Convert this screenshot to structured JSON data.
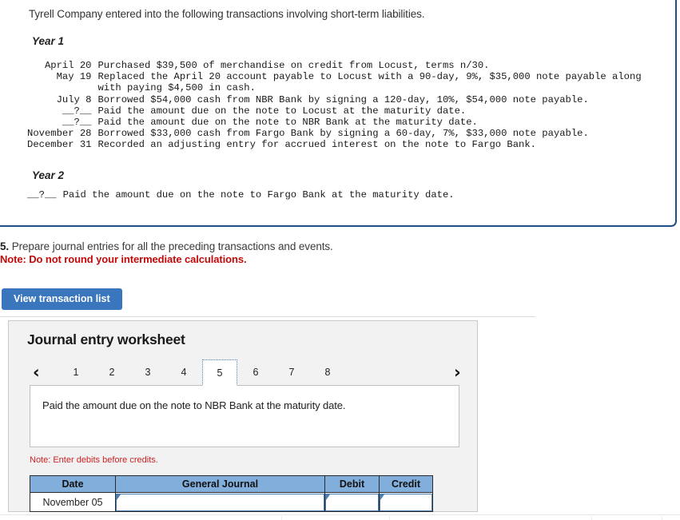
{
  "problem": {
    "intro": "Tyrell Company entered into the following transactions involving short-term liabilities.",
    "year1_label": "Year 1",
    "year2_label": "Year 2",
    "year1_transactions": [
      {
        "date": "April 20",
        "text": "Purchased $39,500 of merchandise on credit from Locust, terms n/30."
      },
      {
        "date": "May 19",
        "text": "Replaced the April 20 account payable to Locust with a 90-day, 9%, $35,000 note payable along"
      },
      {
        "date": "",
        "text": "with paying $4,500 in cash."
      },
      {
        "date": "July 8",
        "text": "Borrowed $54,000 cash from NBR Bank by signing a 120-day, 10%, $54,000 note payable."
      },
      {
        "date": "__?__",
        "text": "Paid the amount due on the note to Locust at the maturity date."
      },
      {
        "date": "__?__",
        "text": "Paid the amount due on the note to NBR Bank at the maturity date."
      },
      {
        "date": "November 28",
        "text": "Borrowed $33,000 cash from Fargo Bank by signing a 60-day, 7%, $33,000 note payable."
      },
      {
        "date": "December 31",
        "text": "Recorded an adjusting entry for accrued interest on the note to Fargo Bank."
      }
    ],
    "year2_transactions": [
      {
        "date": "__?__",
        "text": "Paid the amount due on the note to Fargo Bank at the maturity date."
      }
    ]
  },
  "requirement": {
    "number": "5.",
    "text": "Prepare journal entries for all the preceding transactions and events.",
    "note": "Note: Do not round your intermediate calculations.",
    "note_color": "#c20a0a"
  },
  "toolbar": {
    "view_transaction_list_label": "View transaction list",
    "button_color": "#3a76be"
  },
  "worksheet": {
    "title": "Journal entry worksheet",
    "prev_icon": "chevron-left-icon",
    "next_icon": "chevron-right-icon",
    "prev_glyph": "‹",
    "next_glyph": "›",
    "tabs": [
      "1",
      "2",
      "3",
      "4",
      "5",
      "6",
      "7",
      "8"
    ],
    "active_tab": "5",
    "description": "Paid the amount due on the note to NBR Bank at the maturity date.",
    "debits_note": "Note: Enter debits before credits.",
    "debits_note_color": "#cc2222",
    "table": {
      "headers": [
        "Date",
        "General Journal",
        "Debit",
        "Credit"
      ],
      "header_color": "#82aedb",
      "rows": [
        {
          "date": "November 05",
          "general_journal": "",
          "debit": "",
          "credit": ""
        }
      ]
    }
  }
}
